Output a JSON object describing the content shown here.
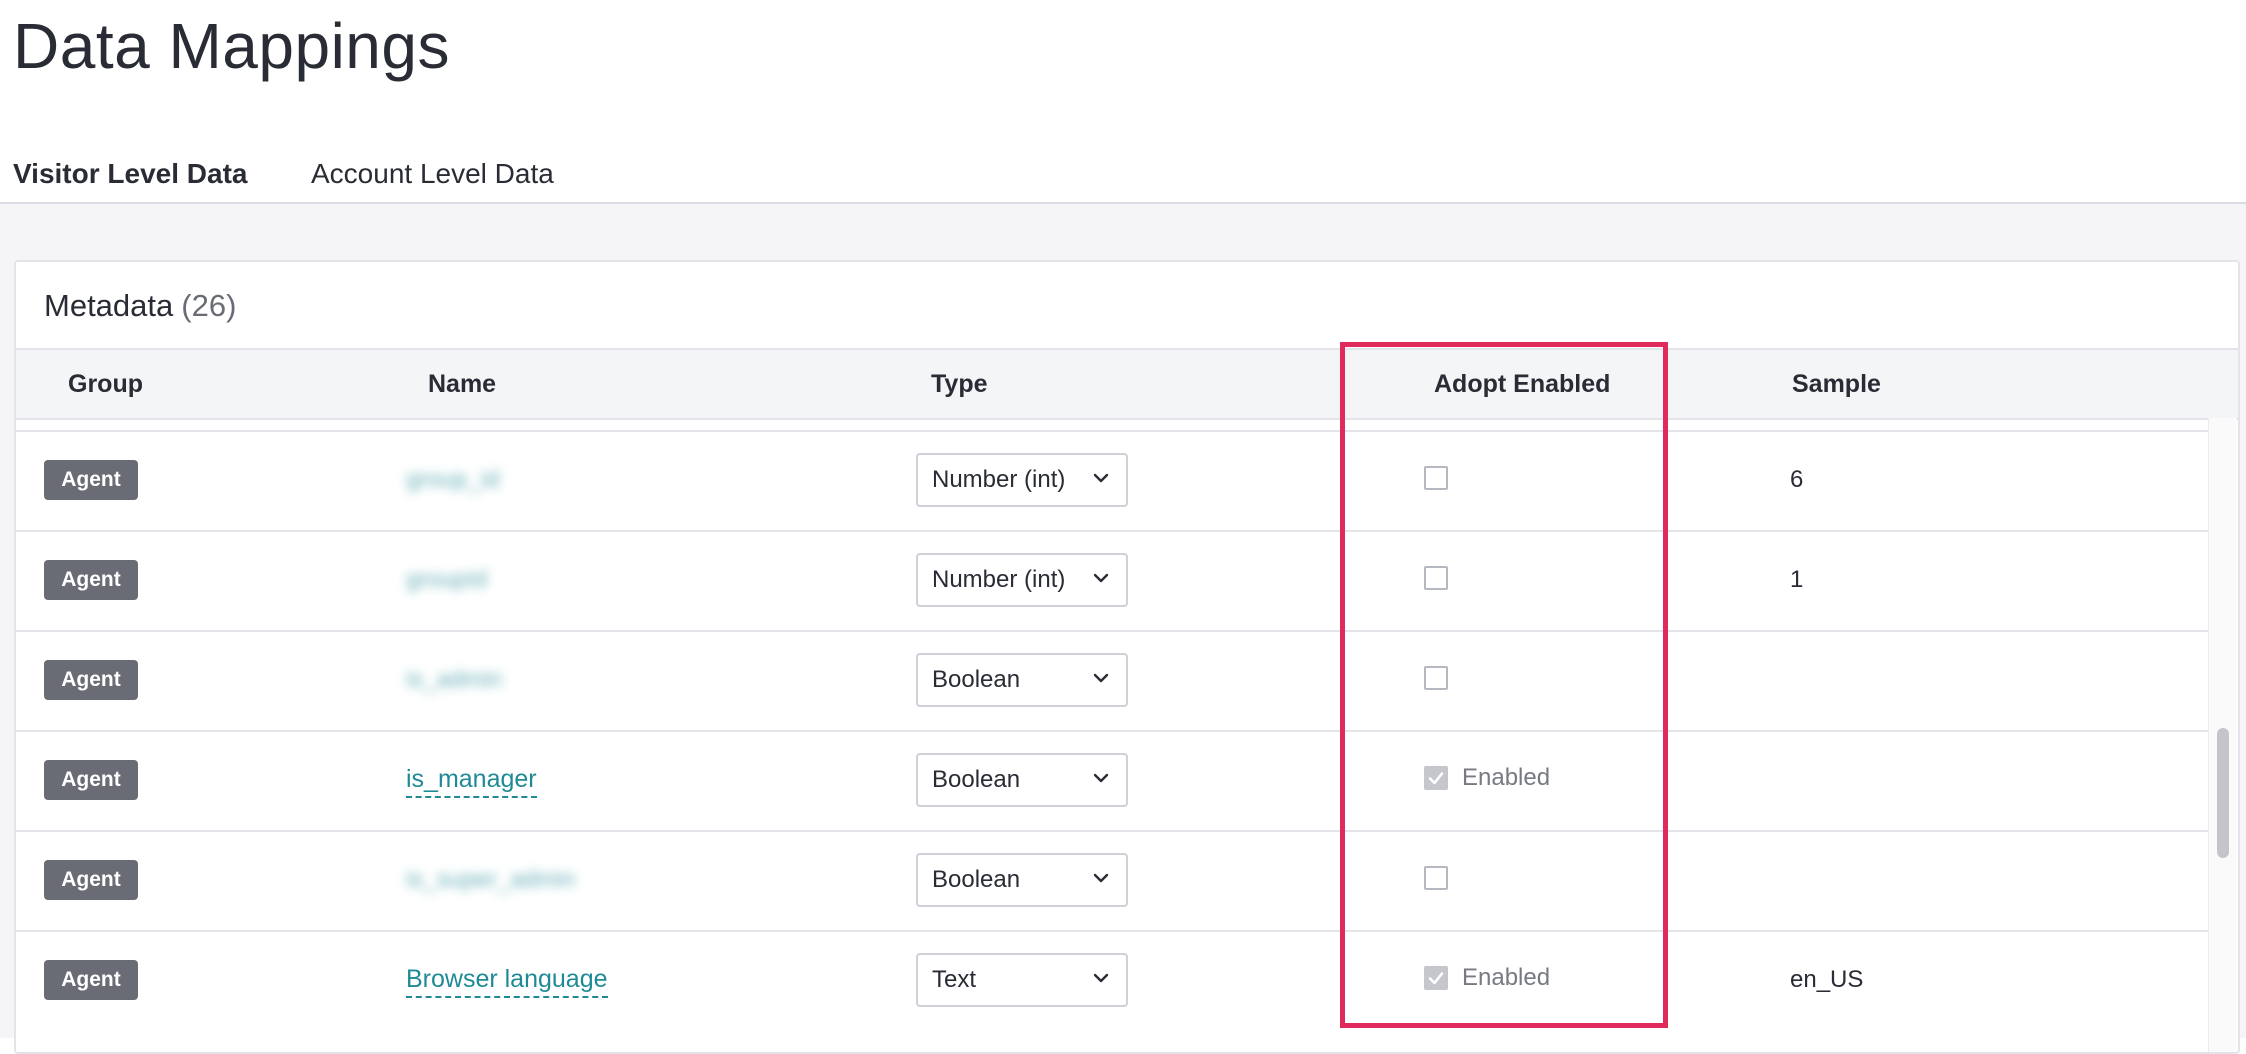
{
  "page": {
    "title": "Data Mappings"
  },
  "tabs": [
    {
      "label": "Visitor Level Data",
      "active": true
    },
    {
      "label": "Account Level Data",
      "active": false
    }
  ],
  "card": {
    "title": "Metadata",
    "count": "(26)"
  },
  "columns": {
    "group": "Group",
    "name": "Name",
    "type": "Type",
    "adopt_enabled": "Adopt Enabled",
    "sample": "Sample"
  },
  "rows": [
    {
      "group": "Agent",
      "name": "group_id",
      "name_blurred": true,
      "type": "Number (int)",
      "adopt_enabled": false,
      "enabled_label": "",
      "sample": "6"
    },
    {
      "group": "Agent",
      "name": "groupId",
      "name_blurred": true,
      "type": "Number (int)",
      "adopt_enabled": false,
      "enabled_label": "",
      "sample": "1"
    },
    {
      "group": "Agent",
      "name": "is_admin",
      "name_blurred": true,
      "type": "Boolean",
      "adopt_enabled": false,
      "enabled_label": "",
      "sample": ""
    },
    {
      "group": "Agent",
      "name": "is_manager",
      "name_blurred": false,
      "type": "Boolean",
      "adopt_enabled": true,
      "enabled_label": "Enabled",
      "sample": ""
    },
    {
      "group": "Agent",
      "name": "is_super_admin",
      "name_blurred": true,
      "type": "Boolean",
      "adopt_enabled": false,
      "enabled_label": "",
      "sample": ""
    },
    {
      "group": "Agent",
      "name": "Browser language",
      "name_blurred": false,
      "type": "Text",
      "adopt_enabled": true,
      "enabled_label": "Enabled",
      "sample": "en_US"
    }
  ],
  "colors": {
    "highlight": "#e02a5c",
    "link": "#1f8a96",
    "badge": "#6a6c75"
  },
  "icons": {
    "select_chevron": "chevron-down-icon",
    "checkbox_check": "checkmark-icon"
  }
}
